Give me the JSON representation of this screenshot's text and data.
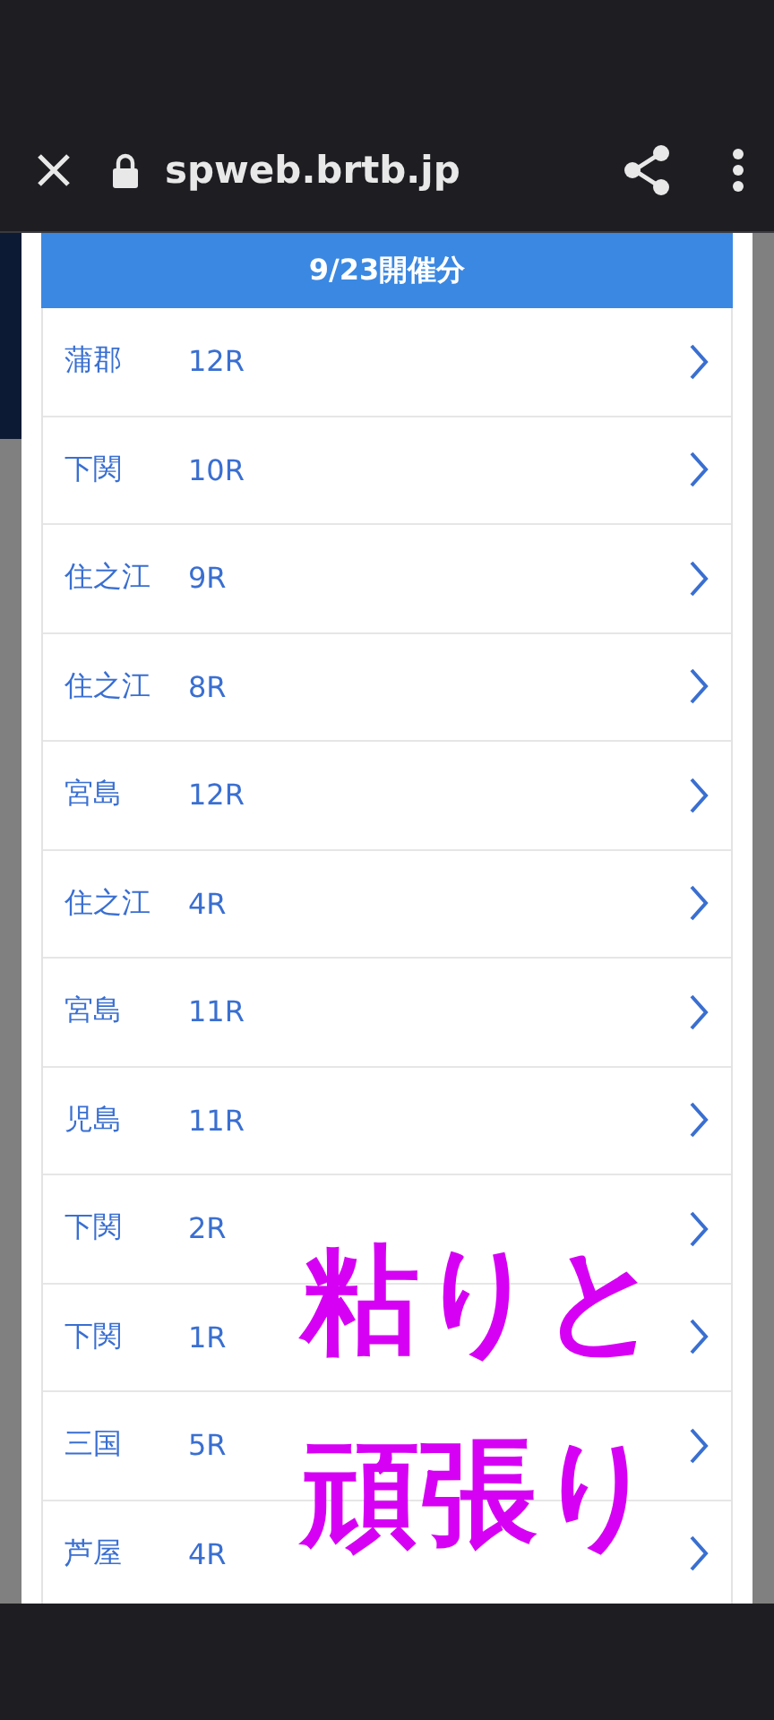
{
  "browser_bar": {
    "url": "spweb.brtb.jp"
  },
  "modal": {
    "title": "9/23開催分",
    "races": [
      {
        "venue": "蒲郡",
        "race": "12R"
      },
      {
        "venue": "下関",
        "race": "10R"
      },
      {
        "venue": "住之江",
        "race": "9R"
      },
      {
        "venue": "住之江",
        "race": "8R"
      },
      {
        "venue": "宮島",
        "race": "12R"
      },
      {
        "venue": "住之江",
        "race": "4R"
      },
      {
        "venue": "宮島",
        "race": "11R"
      },
      {
        "venue": "児島",
        "race": "11R"
      },
      {
        "venue": "下関",
        "race": "2R"
      },
      {
        "venue": "下関",
        "race": "1R"
      },
      {
        "venue": "三国",
        "race": "5R"
      },
      {
        "venue": "芦屋",
        "race": "4R"
      }
    ]
  },
  "caption": {
    "lines": [
      "粘りと",
      "頑張り"
    ]
  }
}
